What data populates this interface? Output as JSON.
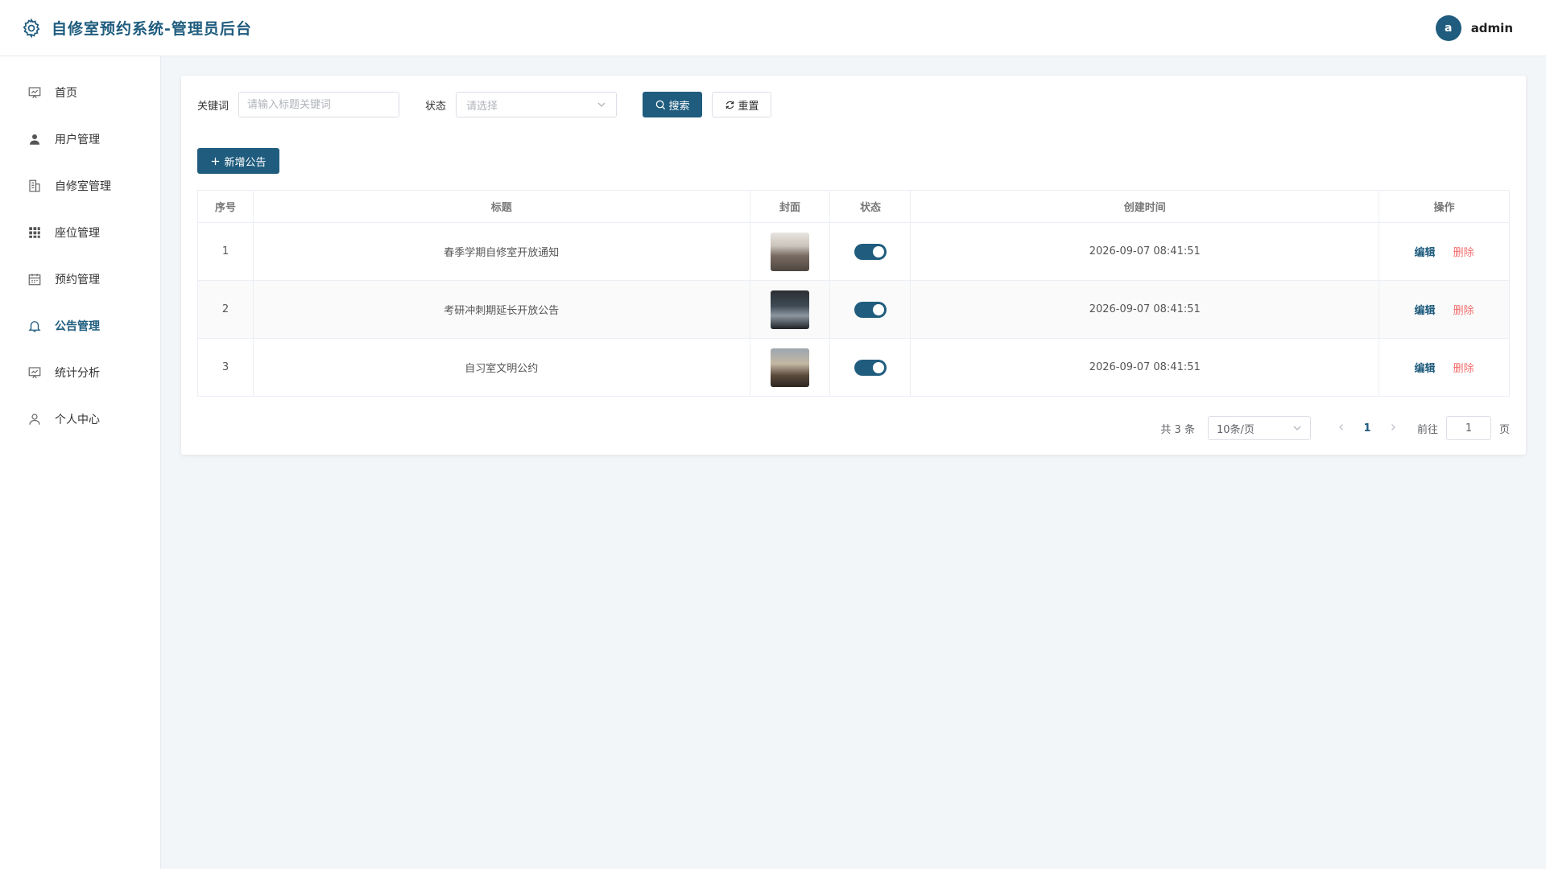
{
  "header": {
    "title": "自修室预约系统-管理员后台",
    "avatar_letter": "a",
    "username": "admin"
  },
  "sidebar": {
    "items": [
      {
        "label": "首页",
        "icon": "chart-board-icon"
      },
      {
        "label": "用户管理",
        "icon": "user-icon"
      },
      {
        "label": "自修室管理",
        "icon": "building-icon"
      },
      {
        "label": "座位管理",
        "icon": "grid-icon"
      },
      {
        "label": "预约管理",
        "icon": "calendar-icon"
      },
      {
        "label": "公告管理",
        "icon": "bell-icon",
        "active": true
      },
      {
        "label": "统计分析",
        "icon": "chart-board-icon"
      },
      {
        "label": "个人中心",
        "icon": "person-icon"
      }
    ]
  },
  "filters": {
    "keyword_label": "关键词",
    "keyword_placeholder": "请输入标题关键词",
    "keyword_value": "",
    "status_label": "状态",
    "status_placeholder": "请选择",
    "search_label": "搜索",
    "reset_label": "重置"
  },
  "toolbar": {
    "add_label": "新增公告"
  },
  "table": {
    "columns": [
      "序号",
      "标题",
      "封面",
      "状态",
      "创建时间",
      "操作"
    ],
    "rows": [
      {
        "index": "1",
        "title": "春季学期自修室开放通知",
        "status_on": true,
        "created": "2026-09-07 08:41:51",
        "edit": "编辑",
        "delete": "删除"
      },
      {
        "index": "2",
        "title": "考研冲刺期延长开放公告",
        "status_on": true,
        "created": "2026-09-07 08:41:51",
        "edit": "编辑",
        "delete": "删除"
      },
      {
        "index": "3",
        "title": "自习室文明公约",
        "status_on": true,
        "created": "2026-09-07 08:41:51",
        "edit": "编辑",
        "delete": "删除"
      }
    ]
  },
  "pagination": {
    "total": "共 3 条",
    "page_size": "10条/页",
    "current_page": "1",
    "jump_label": "前往",
    "jump_value": "1",
    "page_suffix": "页"
  },
  "colors": {
    "primary": "#1f5c7e",
    "danger": "#f56c6c",
    "background": "#f3f6f9"
  }
}
